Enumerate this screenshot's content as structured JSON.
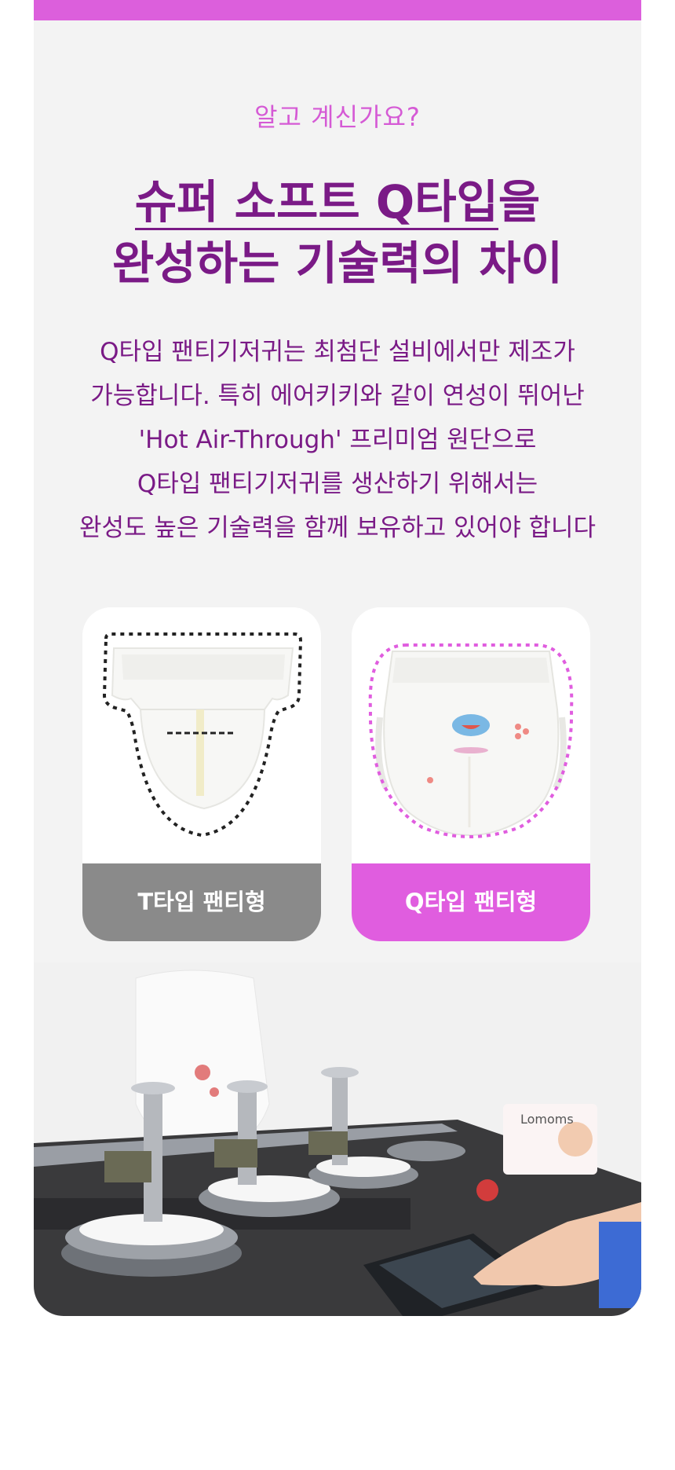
{
  "header": {
    "eyebrow": "알고 계신가요?"
  },
  "headline": {
    "line1_underlined": "슈퍼 소프트 Q타입",
    "line1_suffix": "을",
    "line2": "완성하는 기술력의 차이"
  },
  "description": {
    "lines": [
      "Q타입 팬티기저귀는 최첨단 설비에서만 제조가",
      "가능합니다. 특히 에어키키와 같이 연성이 뛰어난",
      "'Hot Air-Through' 프리미엄 원단으로",
      "Q타입 팬티기저귀를 생산하기 위해서는",
      "완성도 높은 기술력을 함께 보유하고 있어야 합니다"
    ]
  },
  "comparison": {
    "t_type_label": "T타입 팬티형",
    "q_type_label": "Q타입 팬티형"
  },
  "product_box_brand": "Lomoms",
  "colors": {
    "accent": "#dc5fdc",
    "title": "#7a1a86",
    "t_label_bg": "#8a8a8a",
    "q_label_bg": "#e05ddf"
  }
}
